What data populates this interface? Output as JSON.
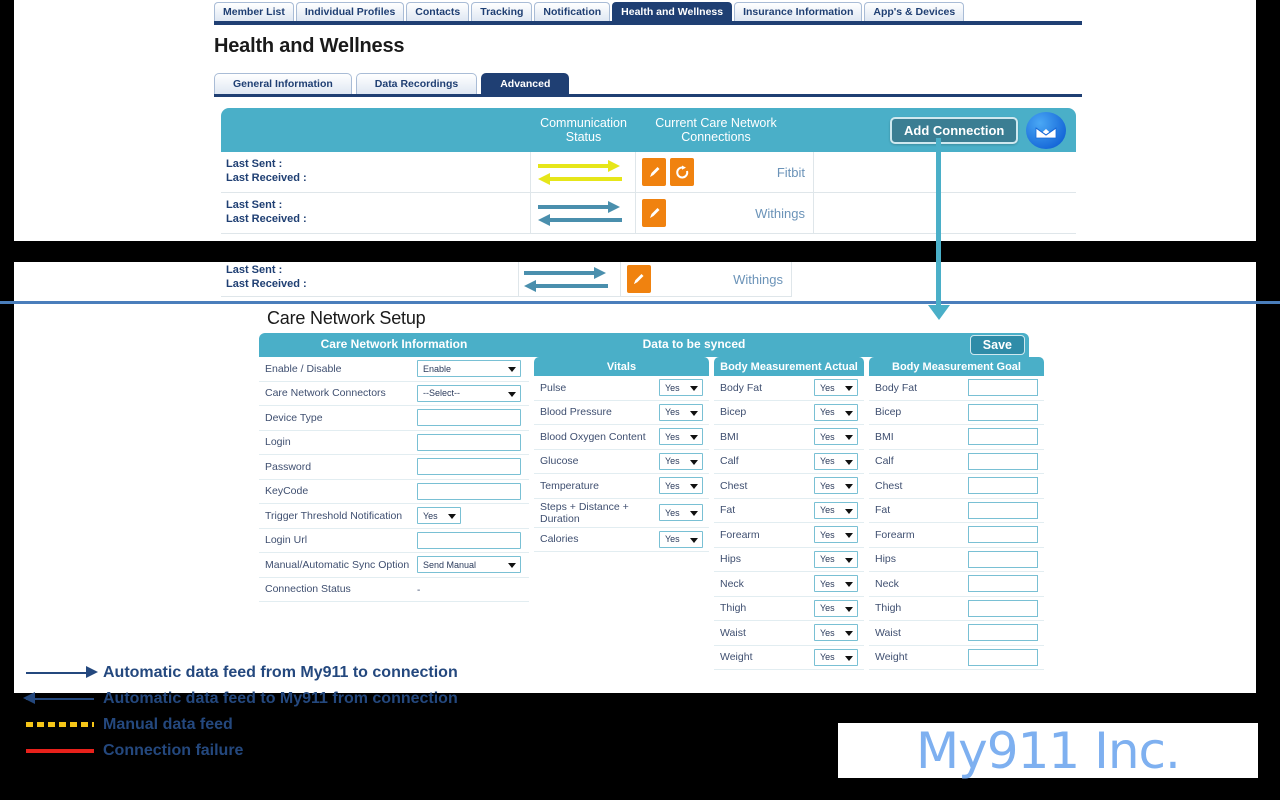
{
  "nav": {
    "tabs": [
      {
        "label": "Member List",
        "active": false
      },
      {
        "label": "Individual Profiles",
        "active": false
      },
      {
        "label": "Contacts",
        "active": false
      },
      {
        "label": "Tracking",
        "active": false
      },
      {
        "label": "Notification",
        "active": false
      },
      {
        "label": "Health and Wellness",
        "active": true
      },
      {
        "label": "Insurance Information",
        "active": false
      },
      {
        "label": "App's & Devices",
        "active": false
      }
    ]
  },
  "page": {
    "title": "Health and Wellness"
  },
  "subtabs": [
    {
      "label": "General Information",
      "active": false
    },
    {
      "label": "Data Recordings",
      "active": false
    },
    {
      "label": "Advanced",
      "active": true
    }
  ],
  "connections": {
    "header": {
      "communication_status": "Communication Status",
      "communication_status_l1": "Communication",
      "communication_status_l2": "Status",
      "current_connections_l1": "Current Care Network",
      "current_connections_l2": "Connections",
      "add_connection_label": "Add Connection",
      "envelope_icon": "envelope-icon"
    },
    "rows": [
      {
        "last_sent_label": "Last Sent :",
        "last_received_label": "Last Received :",
        "arrow_color": "#e6e619",
        "name": "Fitbit",
        "actions": [
          "edit-icon",
          "refresh-icon"
        ]
      },
      {
        "last_sent_label": "Last Sent :",
        "last_received_label": "Last Received :",
        "arrow_color": "#4a8fad",
        "name": "Withings",
        "actions": [
          "edit-icon"
        ]
      }
    ],
    "repeated_row": {
      "last_sent_label": "Last Sent :",
      "last_received_label": "Last Received :",
      "arrow_color": "#4a8fad",
      "name": "Withings"
    }
  },
  "setup": {
    "title": "Care Network Setup",
    "header_care_network_information": "Care Network Information",
    "header_data_to_be_synced": "Data to be synced",
    "save_label": "Save",
    "care_network_information": [
      {
        "label": "Enable / Disable",
        "control": "select",
        "value": "Enable",
        "size": "full"
      },
      {
        "label": "Care Network Connectors",
        "control": "select",
        "value": "--Select--",
        "size": "full"
      },
      {
        "label": "Device Type",
        "control": "text",
        "value": ""
      },
      {
        "label": "Login",
        "control": "text",
        "value": ""
      },
      {
        "label": "Password",
        "control": "text",
        "value": ""
      },
      {
        "label": "KeyCode",
        "control": "text",
        "value": ""
      },
      {
        "label": "Trigger Threshold Notification",
        "control": "select",
        "value": "Yes",
        "size": "small"
      },
      {
        "label": "Login Url",
        "control": "text",
        "value": ""
      },
      {
        "label": "Manual/Automatic Sync Option",
        "control": "select",
        "value": "Send Manual",
        "size": "full"
      },
      {
        "label": "Connection Status",
        "control": "plain",
        "value": "-"
      }
    ],
    "vitals": {
      "header": "Vitals",
      "rows": [
        {
          "label": "Pulse",
          "value": "Yes"
        },
        {
          "label": "Blood Pressure",
          "value": "Yes"
        },
        {
          "label": "Blood Oxygen Content",
          "value": "Yes"
        },
        {
          "label": "Glucose",
          "value": "Yes"
        },
        {
          "label": "Temperature",
          "value": "Yes"
        },
        {
          "label": "Steps + Distance + Duration",
          "value": "Yes"
        },
        {
          "label": "Calories",
          "value": "Yes"
        }
      ]
    },
    "body_actual": {
      "header": "Body Measurement Actual",
      "rows": [
        {
          "label": "Body Fat",
          "value": "Yes"
        },
        {
          "label": "Bicep",
          "value": "Yes"
        },
        {
          "label": "BMI",
          "value": "Yes"
        },
        {
          "label": "Calf",
          "value": "Yes"
        },
        {
          "label": "Chest",
          "value": "Yes"
        },
        {
          "label": "Fat",
          "value": "Yes"
        },
        {
          "label": "Forearm",
          "value": "Yes"
        },
        {
          "label": "Hips",
          "value": "Yes"
        },
        {
          "label": "Neck",
          "value": "Yes"
        },
        {
          "label": "Thigh",
          "value": "Yes"
        },
        {
          "label": "Waist",
          "value": "Yes"
        },
        {
          "label": "Weight",
          "value": "Yes"
        }
      ]
    },
    "body_goal": {
      "header": "Body Measurement Goal",
      "rows": [
        {
          "label": "Body Fat",
          "value": ""
        },
        {
          "label": "Bicep",
          "value": ""
        },
        {
          "label": "BMI",
          "value": ""
        },
        {
          "label": "Calf",
          "value": ""
        },
        {
          "label": "Chest",
          "value": ""
        },
        {
          "label": "Fat",
          "value": ""
        },
        {
          "label": "Forearm",
          "value": ""
        },
        {
          "label": "Hips",
          "value": ""
        },
        {
          "label": "Neck",
          "value": ""
        },
        {
          "label": "Thigh",
          "value": ""
        },
        {
          "label": "Waist",
          "value": ""
        },
        {
          "label": "Weight",
          "value": ""
        }
      ]
    }
  },
  "legend": [
    {
      "label": "Automatic data feed from My911 to connection",
      "style": "arrow-right",
      "color": "#24487e"
    },
    {
      "label": "Automatic data feed to My911 from connection",
      "style": "arrow-left",
      "color": "#24487e"
    },
    {
      "label": "Manual data feed",
      "style": "dashed",
      "color": "#f5c518"
    },
    {
      "label": "Connection failure",
      "style": "solid",
      "color": "#e8211b"
    }
  ],
  "logo": {
    "text": "My911 Inc.",
    "color": "#7eb0f0"
  },
  "colors": {
    "teal": "#4aafc8",
    "navy": "#1f3f73",
    "orange": "#f0820f",
    "yellow_arrow": "#e6e619",
    "blue_arrow": "#4a8fad",
    "legend_text": "#24487e"
  }
}
